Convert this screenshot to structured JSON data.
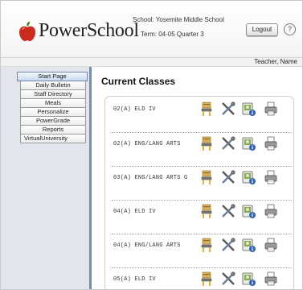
{
  "header": {
    "logo_text": "PowerSchool",
    "school_line": "School:  Yosemite Middle School",
    "term_line": "Term:  04-05 Quarter 3",
    "logout_label": "Logout",
    "help_label": "?",
    "apple_color": "#cc2a1e"
  },
  "teacher_bar": {
    "name": "Teacher, Name"
  },
  "sidebar": {
    "accent": "#6e8fb8",
    "items": [
      {
        "label": "Start Page",
        "active": true
      },
      {
        "label": "Daily Bulletin"
      },
      {
        "label": "Staff Directory"
      },
      {
        "label": "Meals"
      },
      {
        "label": "Personalize"
      },
      {
        "label": "PowerGrade"
      },
      {
        "label": "Reports"
      },
      {
        "label": "VirtualUniversity"
      }
    ]
  },
  "main": {
    "title": "Current Classes",
    "classes": [
      {
        "name": "02(A)  ELD IV"
      },
      {
        "name": "02(A)  ENG/LANG ARTS"
      },
      {
        "name": "03(A)  ENG/LANG ARTS G"
      },
      {
        "name": "04(A)  ELD IV"
      },
      {
        "name": "04(A)  ENG/LANG ARTS"
      },
      {
        "name": "05(A)  ELD IV"
      }
    ],
    "row_icons": [
      "seating-chart-icon",
      "tools-icon",
      "student-info-icon",
      "print-icon"
    ]
  }
}
